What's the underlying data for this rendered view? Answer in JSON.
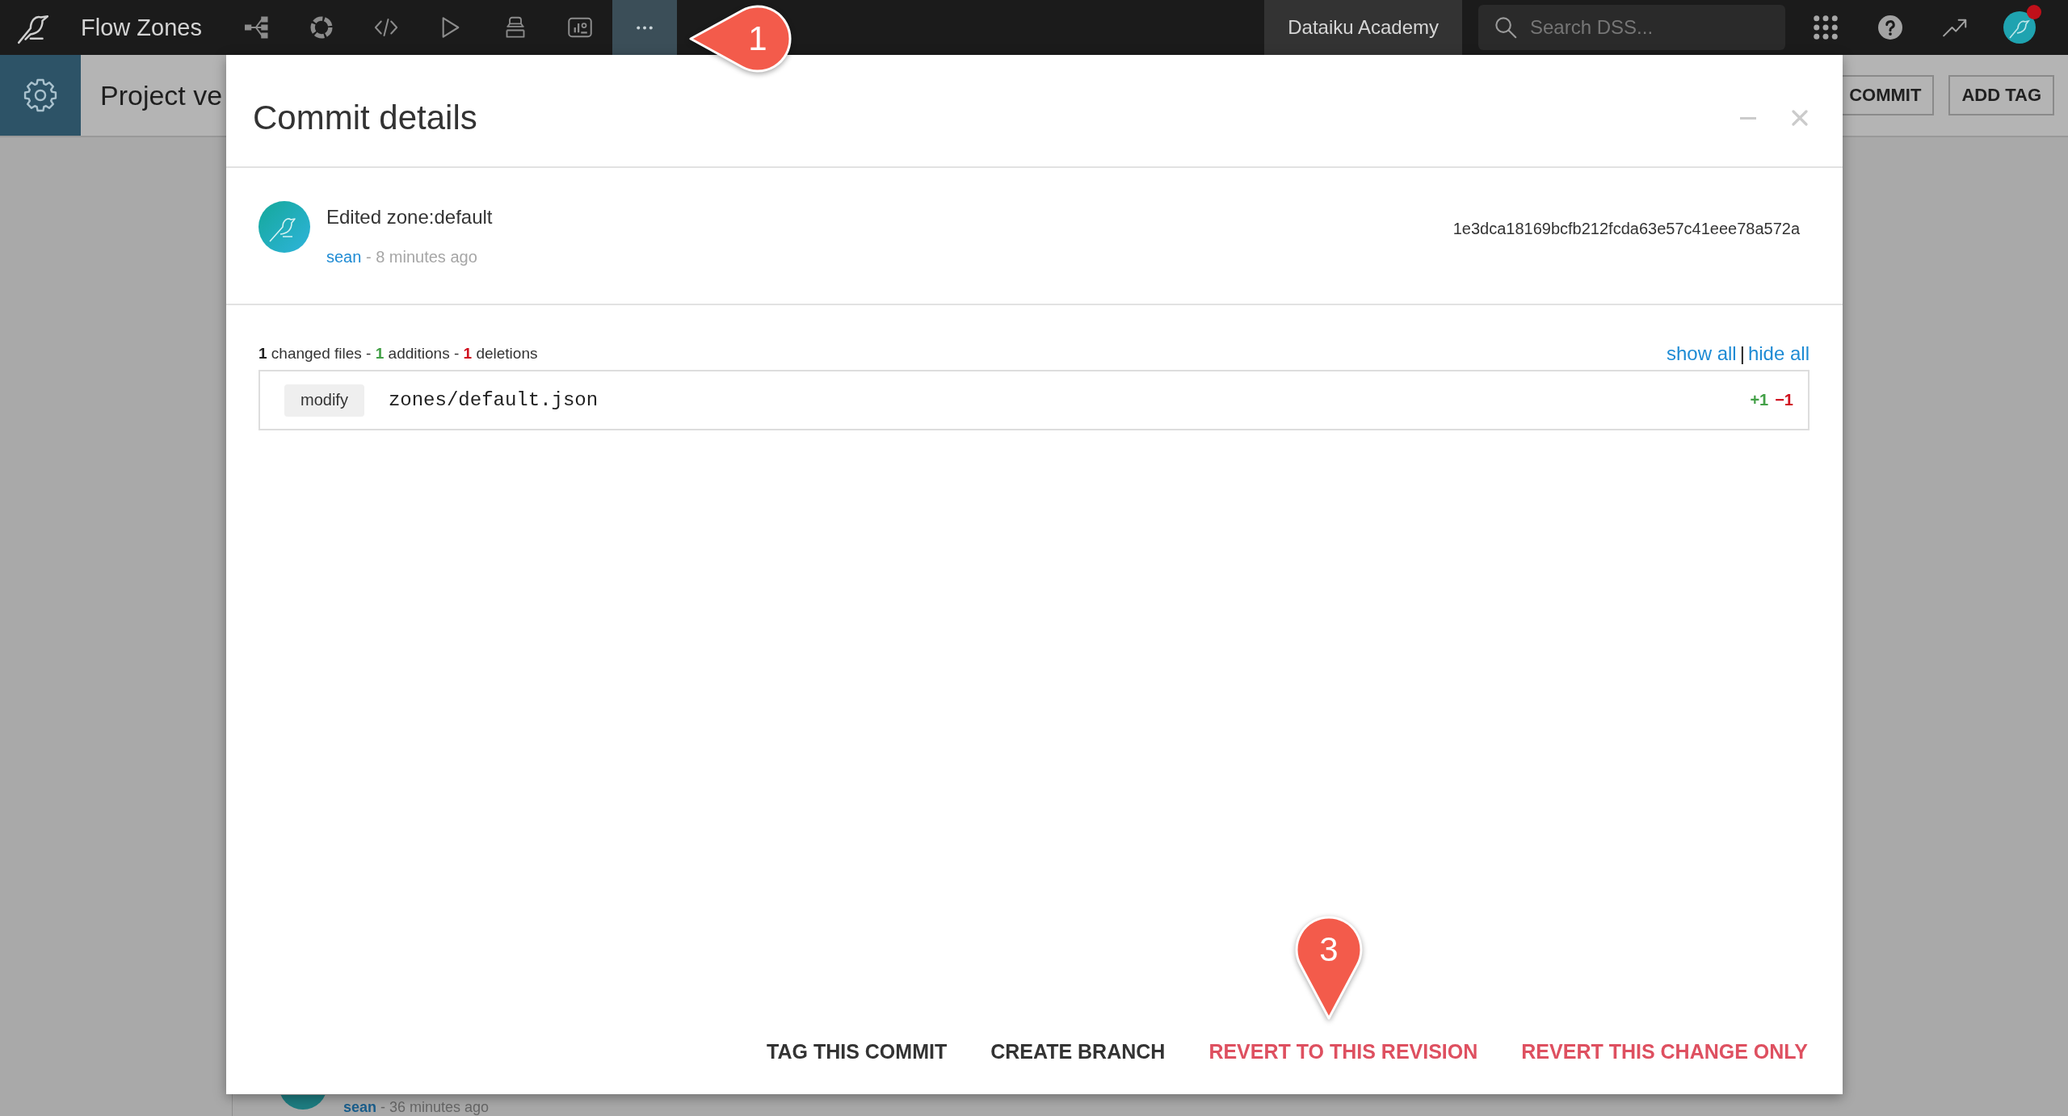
{
  "top_nav": {
    "project_name": "Flow Zones",
    "nav_items": [
      {
        "kind": "flow",
        "selected": false
      },
      {
        "kind": "lab",
        "selected": false
      },
      {
        "kind": "code",
        "selected": false
      },
      {
        "kind": "run",
        "selected": false
      },
      {
        "kind": "deploy",
        "selected": false
      },
      {
        "kind": "dashboard",
        "selected": false
      },
      {
        "kind": "more",
        "selected": true
      }
    ],
    "instance_name": "Dataiku Academy",
    "search": {
      "placeholder": "Search DSS..."
    },
    "user_menu": {
      "notification": true
    }
  },
  "page_header": {
    "title": "Project ve",
    "buttons": [
      "COMMIT",
      "ADD TAG"
    ]
  },
  "history_entry": {
    "author": "sean",
    "time": "- 36 minutes ago"
  },
  "modal": {
    "title": "Commit details",
    "commit": {
      "message": "Edited zone:default",
      "author": "sean",
      "time": "- 8 minutes ago",
      "hash": "1e3dca18169bcfb212fcda63e57c41eee78a572a"
    },
    "summary": [
      {
        "kind": "count",
        "text": "1"
      },
      {
        "kind": "text",
        "text": " changed files - "
      },
      {
        "kind": "added",
        "text": "1"
      },
      {
        "kind": "text",
        "text": " additions - "
      },
      {
        "kind": "removed",
        "text": "1"
      },
      {
        "kind": "text",
        "text": " deletions"
      }
    ],
    "links": [
      {
        "label": "show all"
      },
      {
        "label": "hide all"
      }
    ],
    "link_separator": "|",
    "files": [
      {
        "change": "modify",
        "path": "zones/default.json",
        "additions": "+1",
        "deletions": "−1"
      }
    ],
    "actions": [
      {
        "kind": "neutral",
        "label": "TAG THIS COMMIT"
      },
      {
        "kind": "neutral",
        "label": "CREATE BRANCH"
      },
      {
        "kind": "danger",
        "label": "REVERT TO THIS REVISION"
      },
      {
        "kind": "danger",
        "label": "REVERT THIS CHANGE ONLY"
      }
    ]
  },
  "callouts": [
    {
      "kind": "bubble",
      "label": "1"
    },
    {
      "kind": "pin",
      "label": "3"
    }
  ]
}
